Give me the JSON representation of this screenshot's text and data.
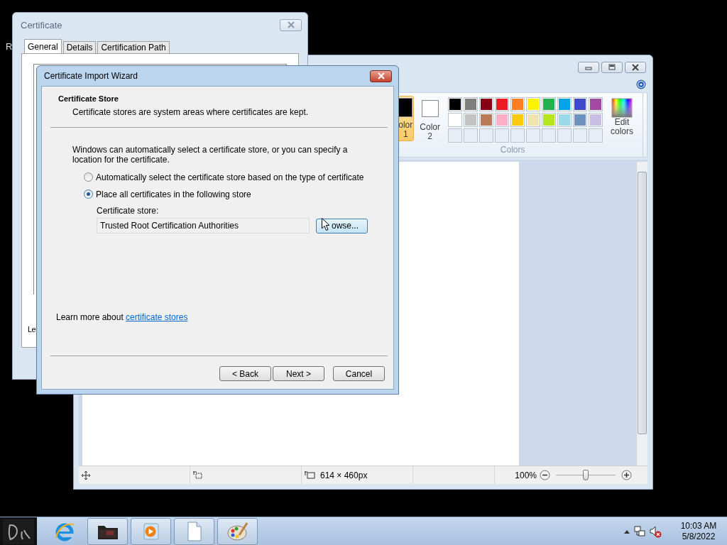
{
  "desktop": {
    "label": "R"
  },
  "paint": {
    "color1": {
      "label": [
        "olor",
        "1"
      ],
      "color": "#000000",
      "selected": true
    },
    "color2": {
      "label": [
        "Color",
        "2"
      ],
      "color": "#ffffff",
      "selected": false
    },
    "palette": [
      {
        "color": "#000000"
      },
      {
        "color": "#7f7f7f"
      },
      {
        "color": "#880015"
      },
      {
        "color": "#ed1c24"
      },
      {
        "color": "#ff7f27"
      },
      {
        "color": "#fff200"
      },
      {
        "color": "#22b14c"
      },
      {
        "color": "#00a2e8"
      },
      {
        "color": "#3f48cc"
      },
      {
        "color": "#a349a4"
      },
      {
        "color": "#ffffff"
      },
      {
        "color": "#c3c3c3"
      },
      {
        "color": "#b97a57"
      },
      {
        "color": "#ffaec9"
      },
      {
        "color": "#ffc90e"
      },
      {
        "color": "#efe4b0"
      },
      {
        "color": "#b5e61d"
      },
      {
        "color": "#99d9ea"
      },
      {
        "color": "#7092be"
      },
      {
        "color": "#c8bfe7"
      },
      {
        "kind": "empty"
      },
      {
        "kind": "empty"
      },
      {
        "kind": "empty"
      },
      {
        "kind": "empty"
      },
      {
        "kind": "empty"
      },
      {
        "kind": "empty"
      },
      {
        "kind": "empty"
      },
      {
        "kind": "empty"
      },
      {
        "kind": "empty"
      },
      {
        "kind": "empty"
      }
    ],
    "edit_colors": [
      "Edit",
      "colors"
    ],
    "group_label": "Colors",
    "status": {
      "dimensions": "614 × 460px",
      "zoom": "100%",
      "zoom_slider": {
        "level": 0.5
      }
    }
  },
  "certificate": {
    "title": "Certificate",
    "tabs": [
      {
        "label": "General",
        "selected": true
      },
      {
        "label": "Details",
        "selected": false
      },
      {
        "label": "Certification Path",
        "selected": false
      }
    ],
    "partial_text": "Le"
  },
  "wizard": {
    "title": "Certificate Import Wizard",
    "header_title": "Certificate Store",
    "header_subtitle": "Certificate stores are system areas where certificates are kept.",
    "intro": "Windows can automatically select a certificate store, or you can specify a location for the certificate.",
    "options": [
      {
        "label": "Automatically select the certificate store based on the type of certificate",
        "selected": false
      },
      {
        "label": "Place all certificates in the following store",
        "selected": true
      }
    ],
    "store_label": "Certificate store:",
    "store_value": "Trusted Root Certification Authorities",
    "browse_button": "owse...",
    "learn_more": "Learn more about",
    "link": "certificate stores",
    "buttons": [
      "< Back",
      "Next >",
      "Cancel"
    ]
  },
  "taskbar": {
    "apps": [
      {
        "kind": "browser",
        "running": false
      },
      {
        "kind": "folder",
        "running": true
      },
      {
        "kind": "media",
        "running": true
      },
      {
        "kind": "document",
        "running": true
      },
      {
        "kind": "paint",
        "running": true
      }
    ],
    "time": "10:03 AM",
    "date": "5/8/2022"
  }
}
